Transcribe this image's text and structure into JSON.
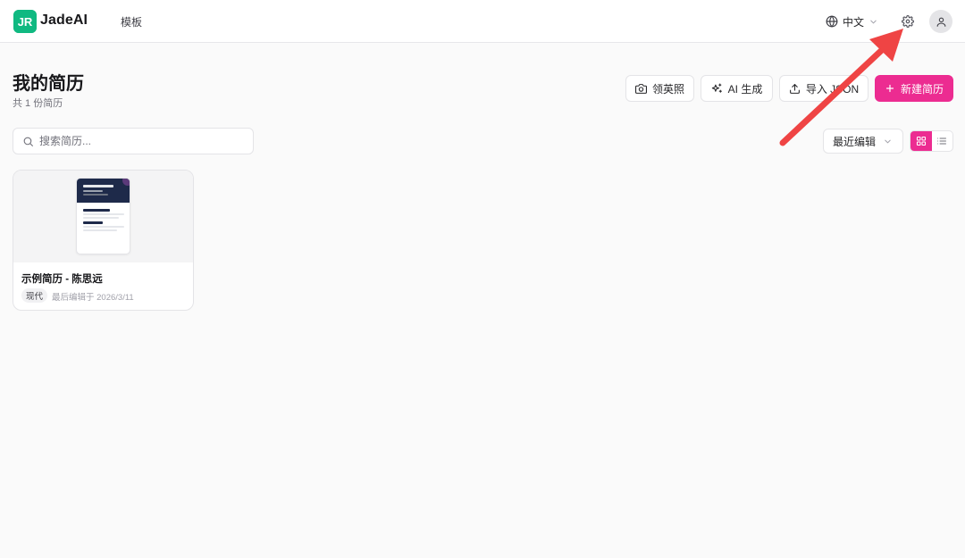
{
  "header": {
    "logo_mark": "JR",
    "logo_text": "JadeAI",
    "nav_templates": "模板",
    "language": "中文"
  },
  "page": {
    "title": "我的简历",
    "subtitle": "共 1 份简历"
  },
  "actions": {
    "photo": "领英照",
    "ai_generate": "AI 生成",
    "import_json": "导入 JSON",
    "new_resume": "新建简历"
  },
  "search": {
    "placeholder": "搜索简历..."
  },
  "sort": {
    "selected": "最近编辑"
  },
  "resumes": [
    {
      "title": "示例简历 - 陈思远",
      "tag": "现代",
      "last_edited": "最后编辑于 2026/3/11"
    }
  ],
  "colors": {
    "primary": "#ec2c91",
    "brand": "#10b981",
    "annotation_arrow": "#ef4444"
  }
}
